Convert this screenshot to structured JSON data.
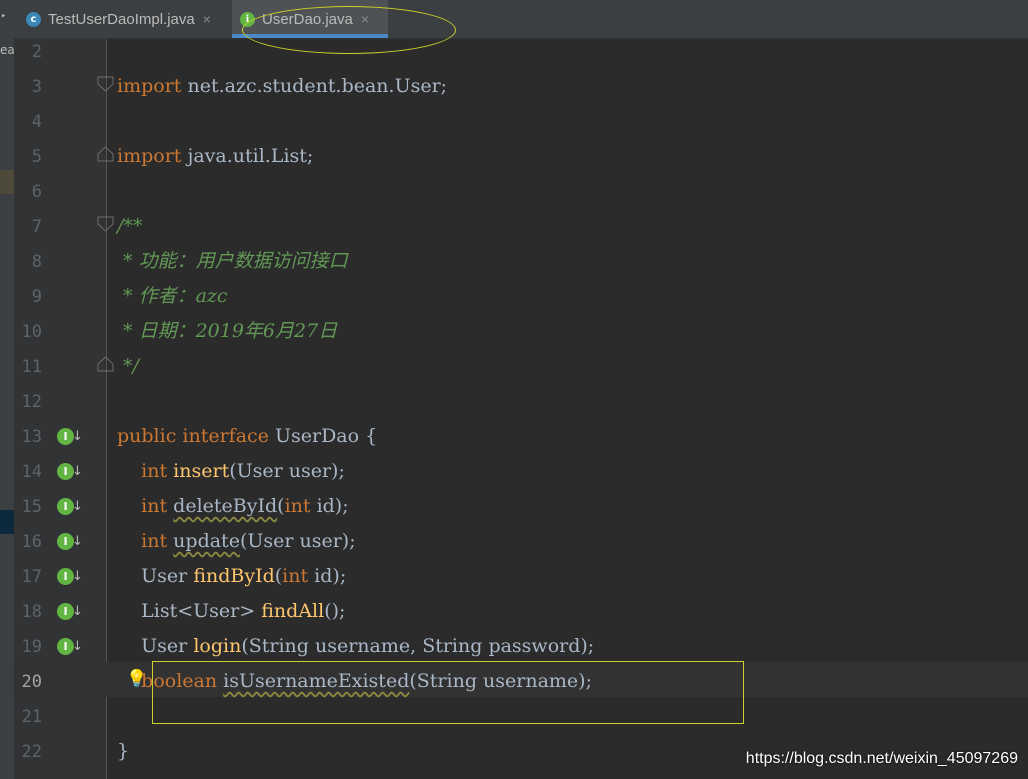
{
  "tabs": [
    {
      "label": "TestUserDaoImpl.java",
      "icon": "c",
      "close": "×",
      "active": false
    },
    {
      "label": "UserDao.java",
      "icon": "i",
      "close": "×",
      "active": true
    }
  ],
  "sidebar_fragment": "ea",
  "gutter": {
    "line_numbers": [
      "2",
      "3",
      "4",
      "5",
      "6",
      "7",
      "8",
      "9",
      "10",
      "11",
      "12",
      "13",
      "14",
      "15",
      "16",
      "17",
      "18",
      "19",
      "20",
      "21",
      "22"
    ],
    "implemented_marker": "I",
    "current_line": "20"
  },
  "code": {
    "l3": {
      "kw": "import",
      "rest": " net.azc.student.bean.User;"
    },
    "l5": {
      "kw": "import",
      "rest": " java.util.List;"
    },
    "l7": "/**",
    "l8": " * 功能：用户数据访问接口",
    "l9": " * 作者：azc",
    "l10": " * 日期：2019年6月27日",
    "l11": " */",
    "l13": {
      "kw1": "public",
      "kw2": "interface",
      "rest": " UserDao {"
    },
    "l14": {
      "type": "int",
      "name": "insert",
      "params": "(User user);"
    },
    "l15": {
      "type": "int",
      "name": "deleteById",
      "p_open": "(",
      "p_kw": "int",
      "p_rest": " id);"
    },
    "l16": {
      "type": "int",
      "name": "update",
      "params": "(User user);"
    },
    "l17": {
      "type": "User ",
      "name": "findById",
      "p_open": "(",
      "p_kw": "int",
      "p_rest": " id);"
    },
    "l18": {
      "type": "List<User> ",
      "name": "findAll",
      "params": "();"
    },
    "l19": {
      "type": "User ",
      "name": "login",
      "params": "(String username, String password);"
    },
    "l20": {
      "type": "boolean",
      "name": "isUsernameExisted",
      "params": "(String username);"
    },
    "l22": "}"
  },
  "watermark": "https://blog.csdn.net/weixin_45097269",
  "colors": {
    "keyword": "#cc7832",
    "comment": "#629755",
    "method": "#ffc66d",
    "text": "#a9b7c6",
    "annotation": "#c9d12a"
  }
}
